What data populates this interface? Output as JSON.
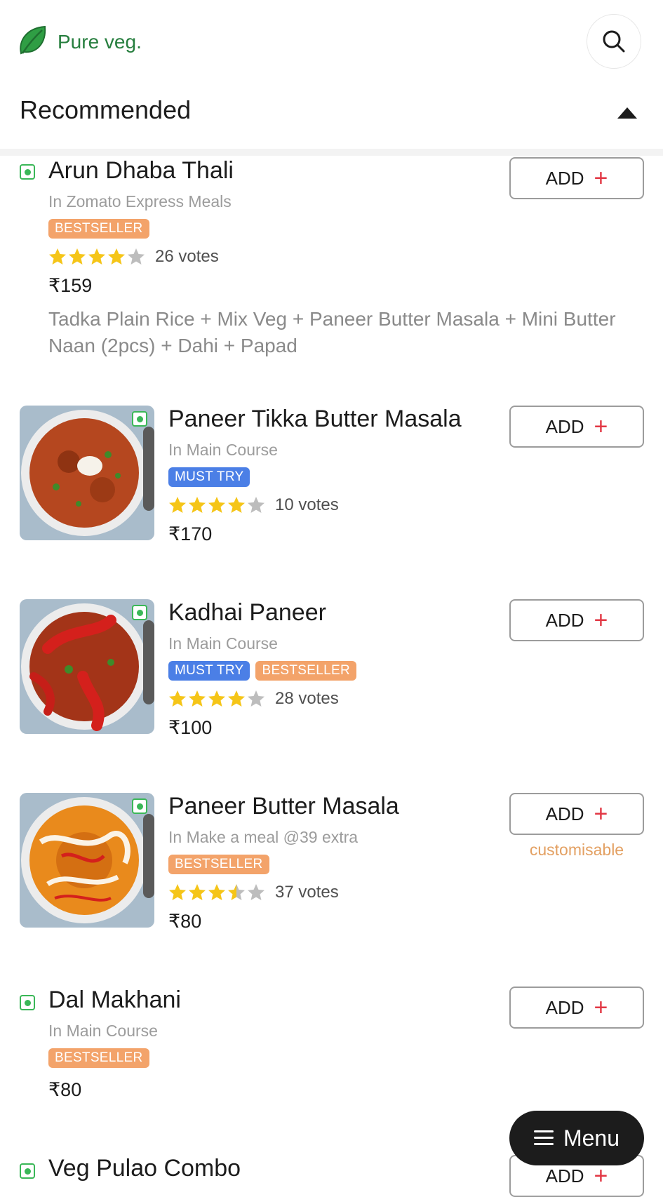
{
  "header": {
    "veg_label": "Pure veg.",
    "section_title": "Recommended"
  },
  "items": [
    {
      "name": "Arun Dhaba Thali",
      "category": "In Zomato Express Meals",
      "tags": [
        "BESTSELLER"
      ],
      "rating": 4,
      "votes": "26 votes",
      "price": "₹159",
      "description": "Tadka Plain Rice + Mix Veg + Paneer Butter Masala + Mini Butter Naan (2pcs) + Dahi + Papad",
      "add_label": "ADD",
      "add_symbol": "+"
    },
    {
      "name": "Paneer Tikka Butter Masala",
      "category": "In Main Course",
      "tags": [
        "MUST TRY"
      ],
      "rating": 4,
      "votes": "10 votes",
      "price": "₹170",
      "add_label": "ADD",
      "add_symbol": "+"
    },
    {
      "name": "Kadhai Paneer",
      "category": "In Main Course",
      "tags": [
        "MUST TRY",
        "BESTSELLER"
      ],
      "rating": 4,
      "votes": "28 votes",
      "price": "₹100",
      "add_label": "ADD",
      "add_symbol": "+"
    },
    {
      "name": "Paneer Butter Masala",
      "category": "In Make a meal @39 extra",
      "tags": [
        "BESTSELLER"
      ],
      "rating": 3.5,
      "votes": "37 votes",
      "price": "₹80",
      "add_label": "ADD",
      "add_symbol": "+",
      "note": "customisable"
    },
    {
      "name": "Dal Makhani",
      "category": "In Main Course",
      "tags": [
        "BESTSELLER"
      ],
      "price": "₹80",
      "add_label": "ADD",
      "add_symbol": "+"
    },
    {
      "name": "Veg Pulao Combo",
      "add_label": "ADD",
      "add_symbol": "+"
    }
  ],
  "menu_button": {
    "label": "Menu"
  },
  "colors": {
    "veg_green": "#3ab757",
    "brand_red": "#e23744",
    "bestseller": "#f3a36a",
    "must_try": "#4b7fe6",
    "star": "#f5c518"
  },
  "icons": [
    "leaf-icon",
    "search-icon",
    "collapse-arrow-icon",
    "veg-indicator-icon",
    "star-icon",
    "hamburger-icon"
  ]
}
